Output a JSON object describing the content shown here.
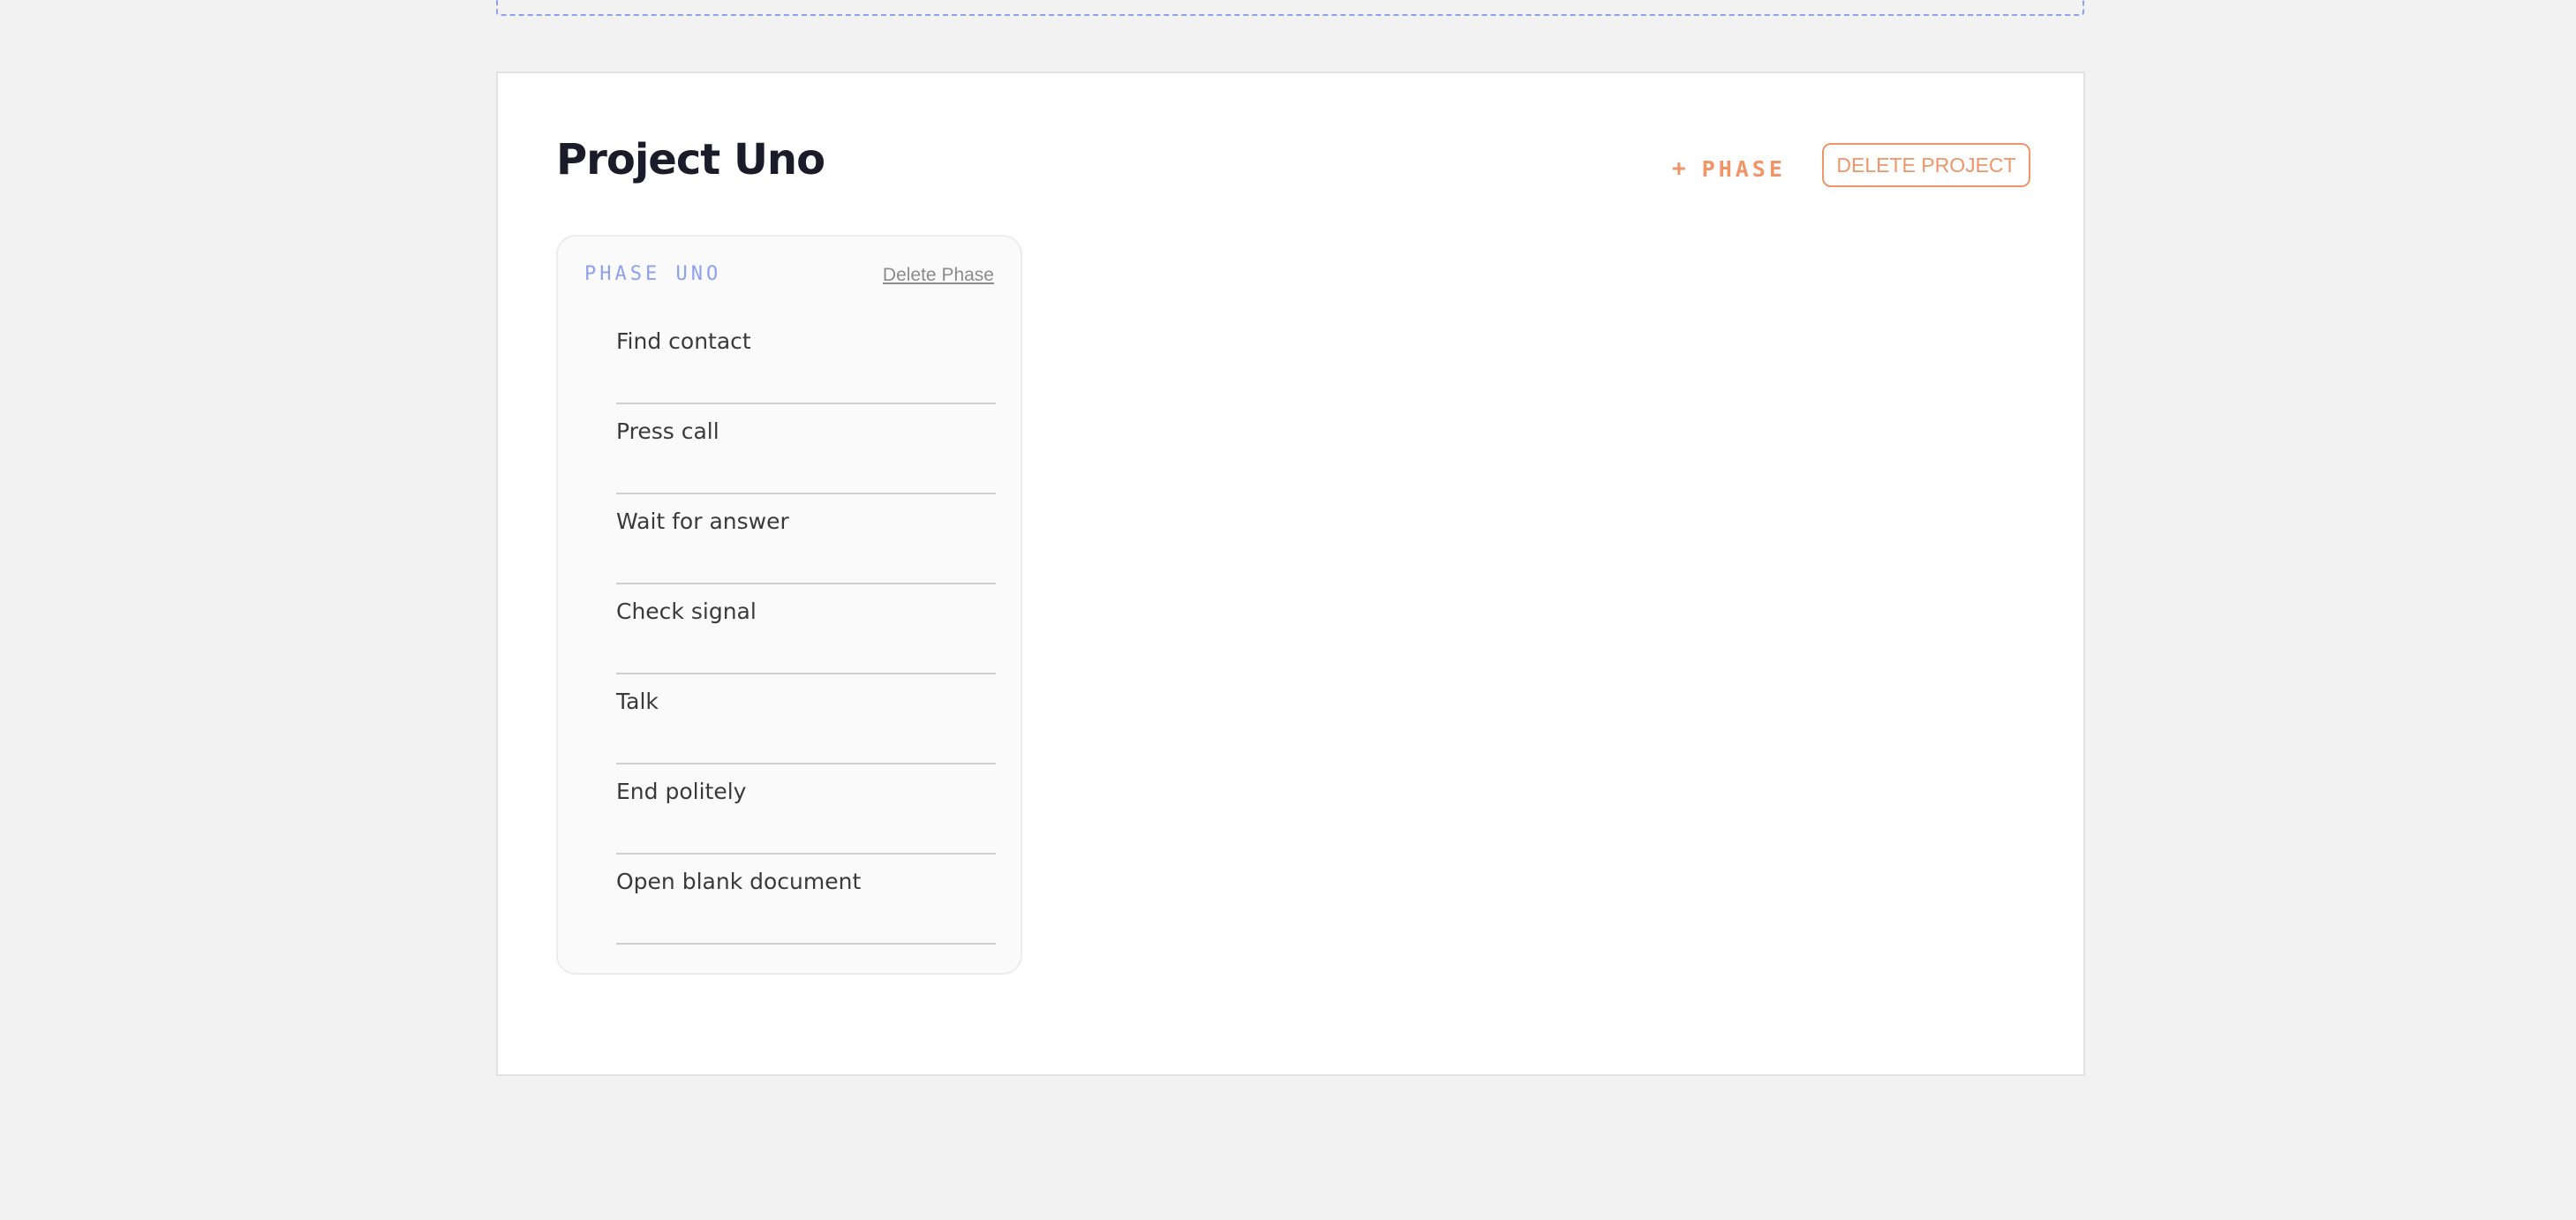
{
  "project": {
    "title": "Project Uno",
    "add_phase_plus": "+",
    "add_phase_label": "PHASE",
    "delete_label": "DELETE PROJECT"
  },
  "phases": [
    {
      "title": "PHASE UNO",
      "delete_label": "Delete Phase",
      "tasks": [
        "Find contact",
        "Press call",
        "Wait for answer",
        "Check signal",
        "Talk",
        "End politely",
        "Open blank document"
      ]
    }
  ],
  "colors": {
    "page_background": "#f2f2f2",
    "card_background": "#ffffff",
    "accent_orange": "#f0956a",
    "accent_blue": "#8ea0f0",
    "title_text": "#1b1b2a"
  }
}
